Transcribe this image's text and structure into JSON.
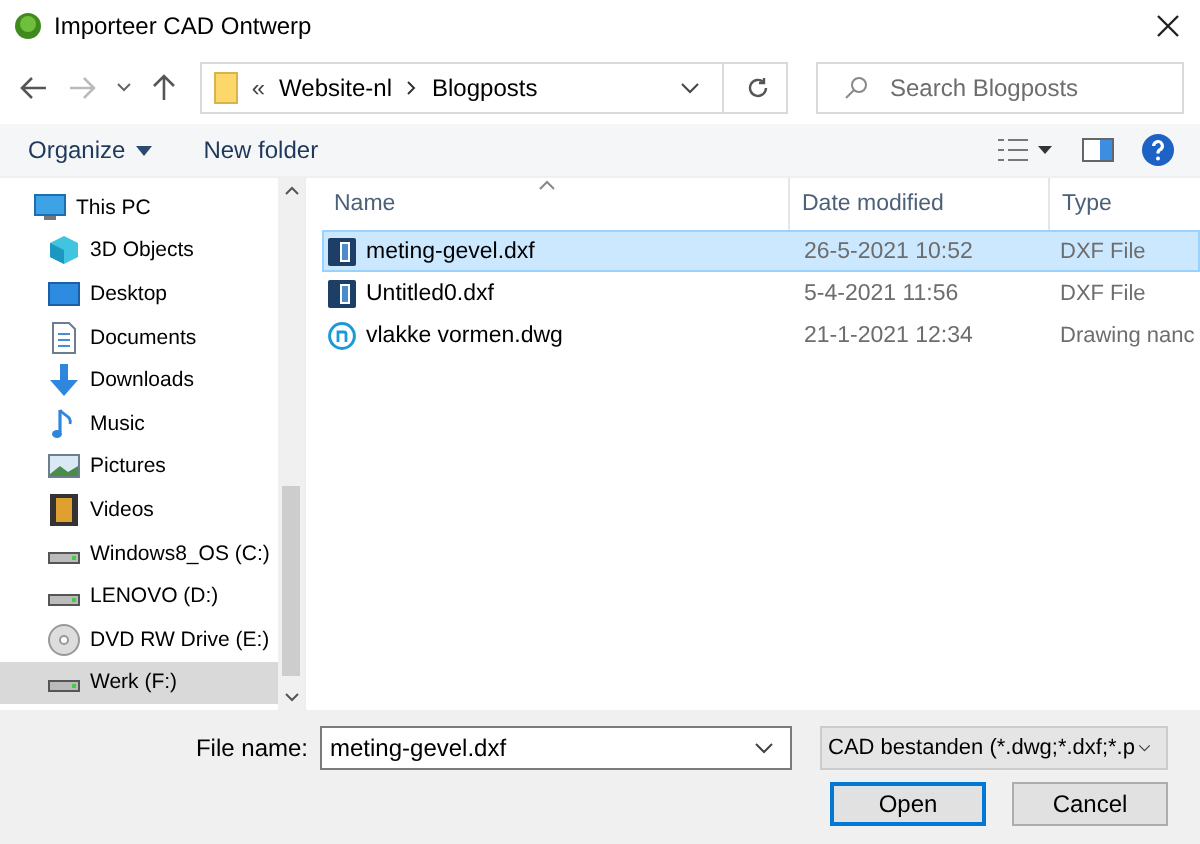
{
  "window": {
    "title": "Importeer CAD Ontwerp"
  },
  "address_bar": {
    "overflow": "«",
    "path": [
      "Website-nl",
      "Blogposts"
    ]
  },
  "search": {
    "placeholder": "Search Blogposts"
  },
  "toolbar": {
    "organize": "Organize",
    "new_folder": "New folder"
  },
  "sidebar": {
    "items": [
      {
        "label": "This PC",
        "selected": false
      },
      {
        "label": "3D Objects",
        "selected": false
      },
      {
        "label": "Desktop",
        "selected": false
      },
      {
        "label": "Documents",
        "selected": false
      },
      {
        "label": "Downloads",
        "selected": false
      },
      {
        "label": "Music",
        "selected": false
      },
      {
        "label": "Pictures",
        "selected": false
      },
      {
        "label": "Videos",
        "selected": false
      },
      {
        "label": "Windows8_OS (C:)",
        "selected": false
      },
      {
        "label": "LENOVO (D:)",
        "selected": false
      },
      {
        "label": "DVD RW Drive (E:)",
        "selected": false
      },
      {
        "label": "Werk (F:)",
        "selected": true
      }
    ]
  },
  "table": {
    "columns": [
      "Name",
      "Date modified",
      "Type"
    ],
    "rows": [
      {
        "name": "meting-gevel.dxf",
        "date": "26-5-2021 10:52",
        "type": "DXF File",
        "selected": true
      },
      {
        "name": "Untitled0.dxf",
        "date": "5-4-2021 11:56",
        "type": "DXF File",
        "selected": false
      },
      {
        "name": "vlakke vormen.dwg",
        "date": "21-1-2021 12:34",
        "type": "Drawing nanc",
        "selected": false
      }
    ]
  },
  "footer": {
    "file_name_label": "File name:",
    "file_name": "meting-gevel.dxf",
    "file_type": "CAD bestanden (*.dwg;*.dxf;*.p",
    "open": "Open",
    "cancel": "Cancel"
  }
}
